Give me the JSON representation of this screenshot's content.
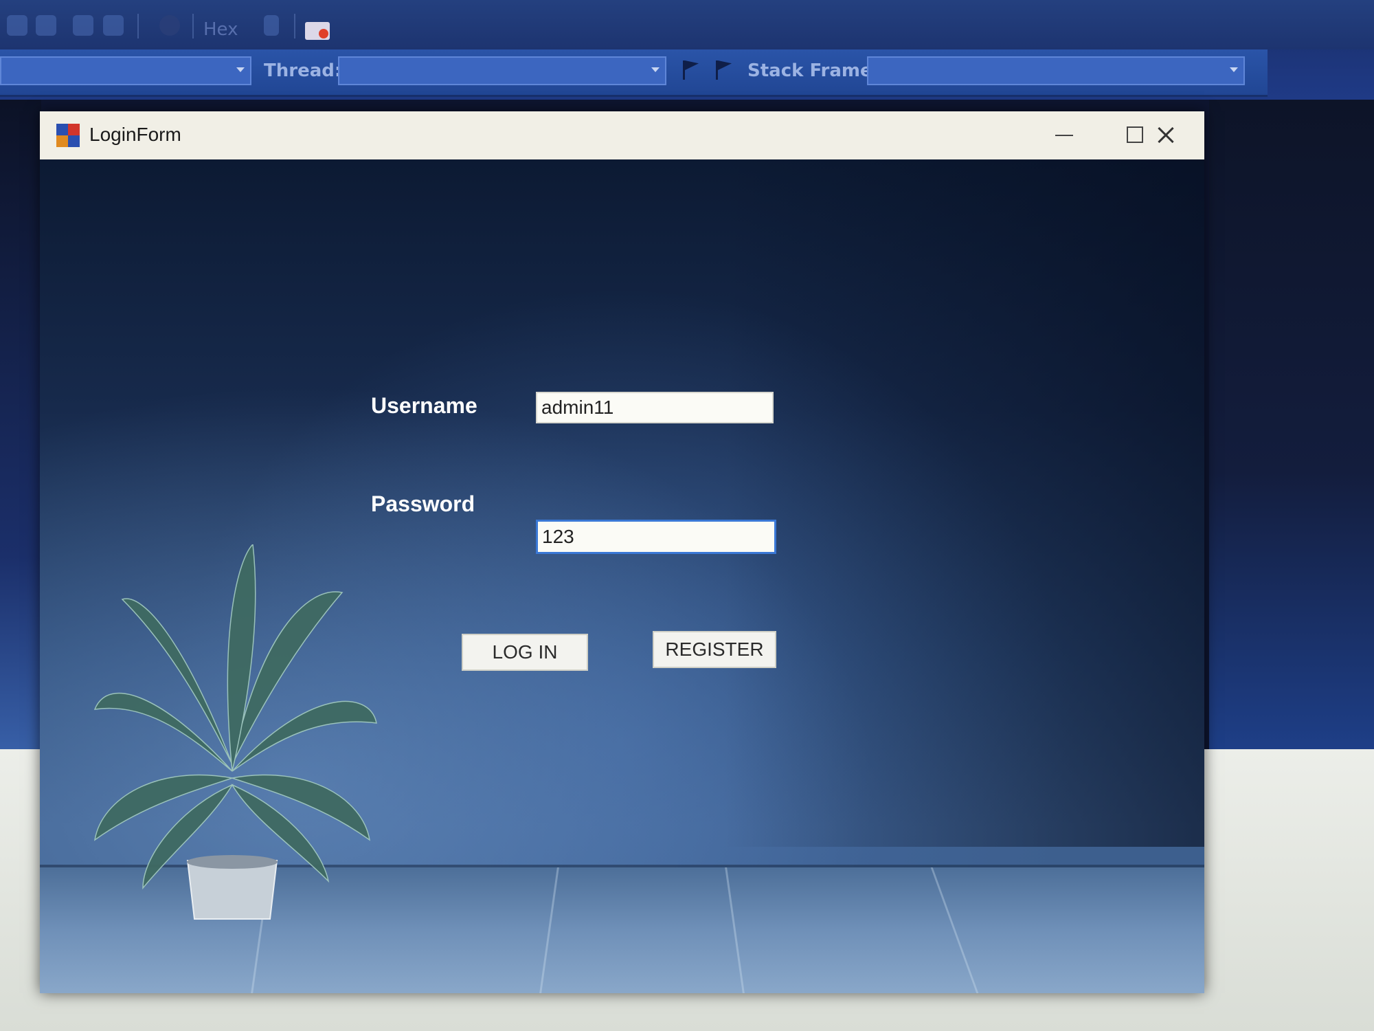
{
  "ide": {
    "toolbar": {
      "hex_label": "Hex",
      "thread_label": "Thread:",
      "stack_frame_label": "Stack Frame:"
    }
  },
  "window": {
    "title": "LoginForm"
  },
  "form": {
    "username_label": "Username",
    "username_value": "admin11",
    "password_label": "Password",
    "password_value": "123",
    "login_label": "LOG IN",
    "register_label": "REGISTER"
  }
}
